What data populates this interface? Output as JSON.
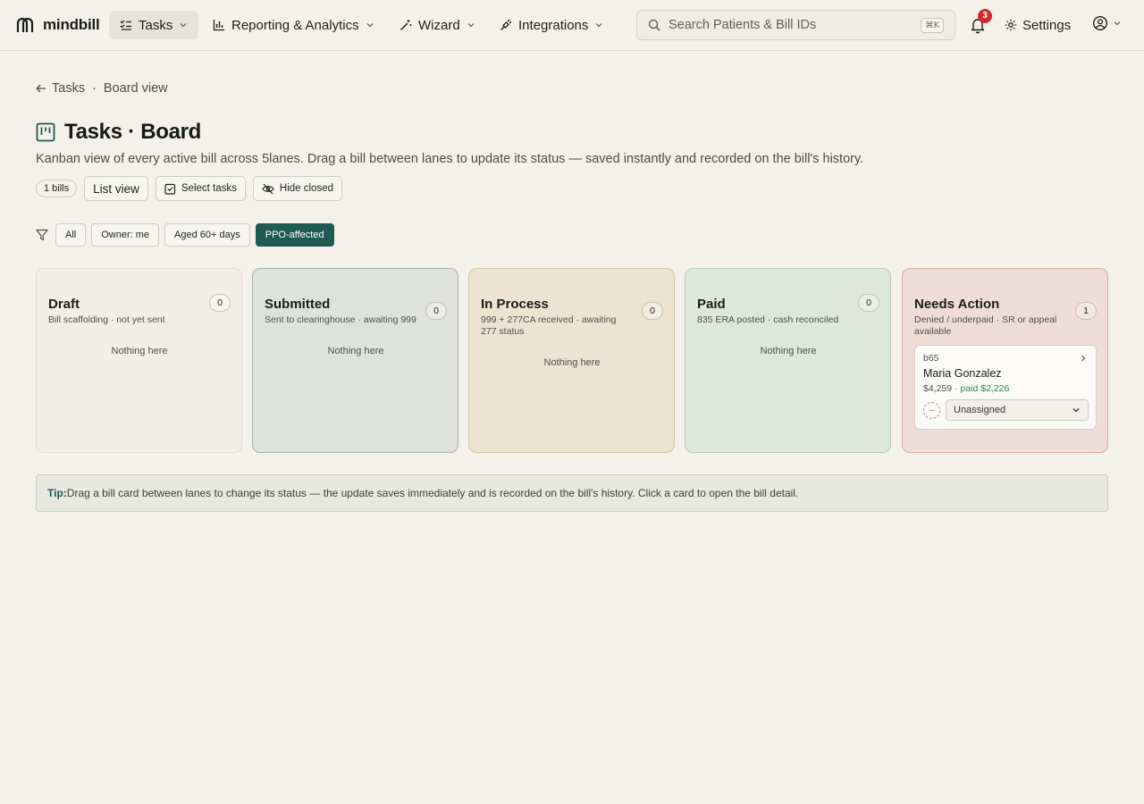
{
  "brand": {
    "name": "mindbill"
  },
  "nav": {
    "items": [
      {
        "label": "Tasks",
        "icon": "list-check-icon"
      },
      {
        "label": "Reporting & Analytics",
        "icon": "bar-chart-icon"
      },
      {
        "label": "Wizard",
        "icon": "wand-icon"
      },
      {
        "label": "Integrations",
        "icon": "plug-icon"
      }
    ],
    "search_placeholder": "Search Patients & Bill IDs",
    "search_shortcut": "⌘K",
    "notification_count": "3",
    "settings_label": "Settings"
  },
  "breadcrumb": {
    "parent": "Tasks",
    "separator": "·",
    "current": "Board view"
  },
  "page": {
    "title": "Tasks · Board",
    "subtitle": "Kanban view of every active bill across 5lanes. Drag a bill between lanes to update its status — saved instantly and recorded on the bill's history.",
    "bill_count": "1 bills",
    "list_view_label": "List view",
    "select_tasks_label": "Select tasks",
    "hide_closed_label": "Hide closed"
  },
  "filters": [
    "All",
    "Owner: me",
    "Aged 60+ days",
    "PPO-affected"
  ],
  "lanes": [
    {
      "title": "Draft",
      "desc": "Bill scaffolding · not yet sent",
      "count": "0",
      "empty": "Nothing here"
    },
    {
      "title": "Submitted",
      "desc": "Sent to clearinghouse · awaiting 999",
      "count": "0",
      "empty": "Nothing here"
    },
    {
      "title": "In Process",
      "desc": "999 + 277CA received · awaiting 277 status",
      "count": "0",
      "empty": "Nothing here"
    },
    {
      "title": "Paid",
      "desc": "835 ERA posted · cash reconciled",
      "count": "0",
      "empty": "Nothing here"
    },
    {
      "title": "Needs Action",
      "desc": "Denied / underpaid · SR or appeal available",
      "count": "1"
    }
  ],
  "card": {
    "id": "b65",
    "patient": "Maria Gonzalez",
    "amount": "$4,259",
    "paid": "· paid $2,226",
    "avatar": "–",
    "assignee": "Unassigned"
  },
  "tip": {
    "label": "Tip:",
    "text": "Drag a bill card between lanes to change its status — the update saves immediately and is recorded on the bill's history. Click a card to open the bill detail."
  },
  "colors": {
    "accent": "#1f5a55",
    "badge": "#cf2b2b",
    "paid_text": "#2c8a4b",
    "lane_draft": "#f1eee6",
    "lane_submitted": "#dfe2dc",
    "lane_in_process": "#ece3d0",
    "lane_paid": "#dfe7da",
    "lane_needs_action": "#f0dcd6"
  }
}
